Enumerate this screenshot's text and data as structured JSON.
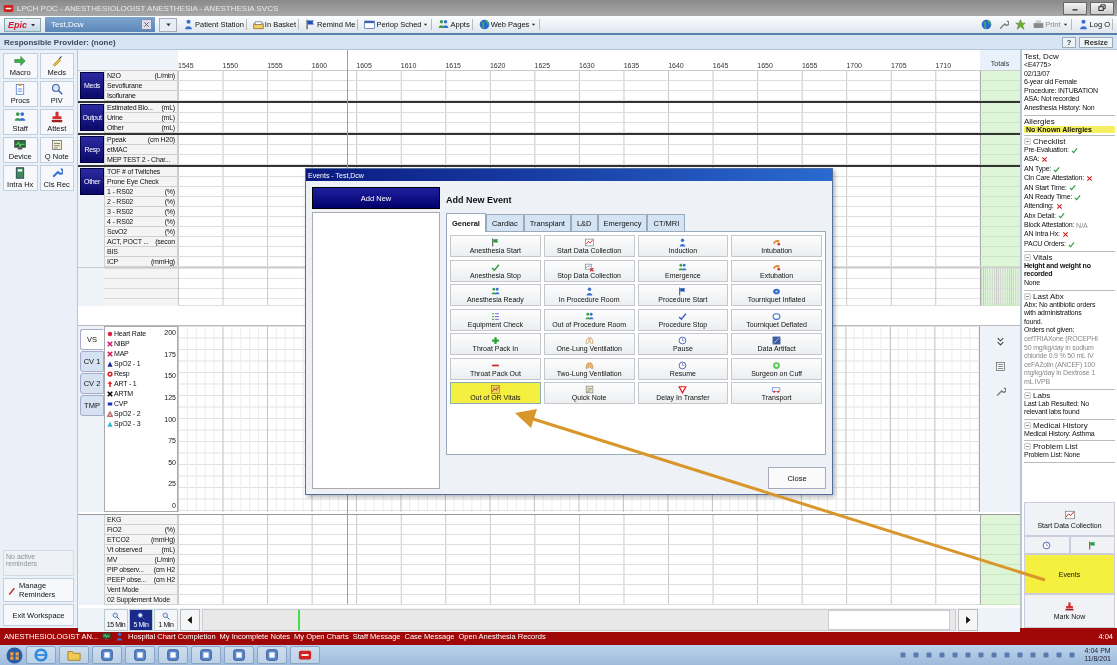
{
  "window": {
    "title": "LPCH POC - ANESTHESIOLOGIST ANESTHESIA - ANESTHESIA SVCS"
  },
  "toolbar": {
    "app_button": "Epic",
    "patient_tab": "Test,Dcw",
    "items": [
      {
        "label": "Patient Station",
        "dropdown": false
      },
      {
        "label": "In Basket",
        "dropdown": false
      },
      {
        "label": "Remind Me",
        "dropdown": false
      },
      {
        "label": "Periop Sched",
        "dropdown": true
      },
      {
        "label": "Appts",
        "dropdown": false
      },
      {
        "label": "Web Pages",
        "dropdown": true
      }
    ],
    "right_items": [
      {
        "label": "Print",
        "dropdown": true
      },
      {
        "label": "Log O",
        "dropdown": false
      }
    ]
  },
  "header": {
    "provider": "Responsible Provider: (none)",
    "help": "?",
    "resize": "Resize"
  },
  "sidebar": {
    "buttons": [
      "Macro",
      "Meds",
      "Procs",
      "PIV",
      "Staff",
      "Attest",
      "Device",
      "Q Note",
      "Intra Hx",
      "Cls Rec"
    ],
    "reminders": "No active reminders",
    "manage": "Manage Reminders",
    "exit": "Exit Workspace"
  },
  "flowsheet": {
    "times": [
      "1545",
      "1550",
      "1555",
      "1600",
      "1605",
      "1610",
      "1615",
      "1620",
      "1625",
      "1630",
      "1635",
      "1640",
      "1645",
      "1650",
      "1655",
      "1700",
      "1705",
      "1710"
    ],
    "totals": "Totals",
    "groups": [
      {
        "label": "Meds",
        "rows": [
          {
            "name": "N2O",
            "unit": "(L/min)"
          },
          {
            "name": "Sevoflurane"
          },
          {
            "name": "Isoflurane"
          }
        ]
      },
      {
        "label": "Output",
        "rows": [
          {
            "name": "Estimated Blo...",
            "unit": "(mL)"
          },
          {
            "name": "Urine",
            "unit": "(mL)"
          },
          {
            "name": "Other",
            "unit": "(mL)"
          }
        ]
      },
      {
        "label": "Resp",
        "rows": [
          {
            "name": "Ppeak",
            "unit": "(cm H20)"
          },
          {
            "name": "etMAC"
          },
          {
            "name": "MEP TEST 2 - Char..."
          }
        ]
      },
      {
        "label": "Other",
        "rows": [
          {
            "name": "TOF # of Twitches"
          },
          {
            "name": "Prone Eye Check"
          },
          {
            "name": "1 - RS02",
            "unit": "(%)"
          },
          {
            "name": "2 - RS02",
            "unit": "(%)"
          },
          {
            "name": "3 - RS02",
            "unit": "(%)"
          },
          {
            "name": "4 - RS02",
            "unit": "(%)"
          },
          {
            "name": "ScvO2",
            "unit": "(%)"
          },
          {
            "name": "ACT, POCT ...",
            "unit": "(secon"
          },
          {
            "name": "BIS"
          },
          {
            "name": "ICP",
            "unit": "(mmHg)"
          }
        ]
      }
    ]
  },
  "vitals": {
    "tabs": [
      {
        "label": "VS",
        "selected": true
      },
      {
        "label": "CV 1",
        "selected": false
      },
      {
        "label": "CV 2",
        "selected": false
      },
      {
        "label": "TMP",
        "selected": false
      }
    ],
    "legend": [
      {
        "label": "Heart Rate",
        "kind": "dot",
        "color": "#e0204a"
      },
      {
        "label": "NIBP",
        "kind": "x",
        "color": "#d01870"
      },
      {
        "label": "MAP",
        "kind": "x",
        "color": "#d01850"
      },
      {
        "label": "SpO2 - 1",
        "kind": "triangle",
        "color": "#1a2a9a"
      },
      {
        "label": "Resp",
        "kind": "ring",
        "color": "#e02020"
      },
      {
        "label": "ART - 1",
        "kind": "arrow",
        "color": "#e02020"
      },
      {
        "label": "ARTM",
        "kind": "x",
        "color": "#000000"
      },
      {
        "label": "CVP",
        "kind": "square",
        "color": "#2030c0"
      },
      {
        "label": "SpO2 - 2",
        "kind": "triangle-outline",
        "color": "#c07070"
      },
      {
        "label": "SpO2 - 3",
        "kind": "triangle",
        "color": "#30c0d0"
      }
    ],
    "y_ticks": [
      "200",
      "175",
      "150",
      "125",
      "100",
      "75",
      "50",
      "25",
      "0"
    ]
  },
  "bottom_rows": [
    {
      "name": "EKG"
    },
    {
      "name": "FiO2",
      "unit": "(%)"
    },
    {
      "name": "ETCO2",
      "unit": "(mmHg)"
    },
    {
      "name": "Vt observed",
      "unit": "(mL)"
    },
    {
      "name": "MV",
      "unit": "(L/min)"
    },
    {
      "name": "PIP observ...",
      "unit": "(cm H2"
    },
    {
      "name": "PEEP obse...",
      "unit": "(cm H2"
    },
    {
      "name": "Vent Mode"
    },
    {
      "name": "02 Supplement Mode"
    }
  ],
  "zoom_buttons": [
    {
      "label": "15 Min",
      "selected": false
    },
    {
      "label": "5 Min",
      "selected": true
    },
    {
      "label": "1 Min",
      "selected": false
    }
  ],
  "dialog": {
    "title": "Events - Test,Dcw",
    "add_new": "Add New",
    "heading": "Add New Event",
    "tabs": [
      {
        "label": "General",
        "selected": true
      },
      {
        "label": "Cardiac",
        "selected": false
      },
      {
        "label": "Transplant",
        "selected": false
      },
      {
        "label": "L&D",
        "selected": false
      },
      {
        "label": "Emergency",
        "selected": false
      },
      {
        "label": "CT/MRI",
        "selected": false
      }
    ],
    "events": [
      {
        "label": "Anesthesia Start",
        "highlighted": false
      },
      {
        "label": "Start Data Collection",
        "highlighted": false
      },
      {
        "label": "Induction",
        "highlighted": false
      },
      {
        "label": "Intubation",
        "highlighted": false
      },
      {
        "label": "Anesthesia Stop",
        "highlighted": false
      },
      {
        "label": "Stop Data Collection",
        "highlighted": false
      },
      {
        "label": "Emergence",
        "highlighted": false
      },
      {
        "label": "Extubation",
        "highlighted": false
      },
      {
        "label": "Anesthesia Ready",
        "highlighted": false
      },
      {
        "label": "In Procedure Room",
        "highlighted": false
      },
      {
        "label": "Procedure Start",
        "highlighted": false
      },
      {
        "label": "Tourniquet Inflated",
        "highlighted": false
      },
      {
        "label": "Equipment Check",
        "highlighted": false
      },
      {
        "label": "Out of Procedure Room",
        "highlighted": false
      },
      {
        "label": "Procedure Stop",
        "highlighted": false
      },
      {
        "label": "Tourniquet Deflated",
        "highlighted": false
      },
      {
        "label": "Throat Pack In",
        "highlighted": false
      },
      {
        "label": "One-Lung Ventilation",
        "highlighted": false
      },
      {
        "label": "Pause",
        "highlighted": false
      },
      {
        "label": "Data Artifact",
        "highlighted": false
      },
      {
        "label": "Throat Pack Out",
        "highlighted": false
      },
      {
        "label": "Two-Lung Ventilation",
        "highlighted": false
      },
      {
        "label": "Resume",
        "highlighted": false
      },
      {
        "label": "Surgeon on Cuff",
        "highlighted": false
      },
      {
        "label": "Out of OR Vitals",
        "highlighted": true
      },
      {
        "label": "Quick Note",
        "highlighted": false
      },
      {
        "label": "Delay In Transfer",
        "highlighted": false
      },
      {
        "label": "Transport",
        "highlighted": false
      }
    ],
    "close": "Close"
  },
  "patient": {
    "name": "Test, Dcw",
    "details": [
      "<E4775>",
      "02/13/07",
      "6-year old Female",
      "Procedure: INTUBATION",
      "ASA: Not recorded",
      "Anesthesia History: Non"
    ]
  },
  "allergies": {
    "title": "Allergies",
    "value": "No Known Allergies"
  },
  "checklist": {
    "title": "Checklist",
    "expanded": true,
    "items": [
      {
        "label": "Pre-Evaluation:",
        "kind": "done"
      },
      {
        "label": "ASA:",
        "kind": "missing"
      },
      {
        "label": "AN Type:",
        "kind": "done"
      },
      {
        "label": "Cln Care Attestation:",
        "kind": "missing"
      },
      {
        "label": "AN Start Time:",
        "kind": "done"
      },
      {
        "label": "AN Ready Time:",
        "kind": "done"
      },
      {
        "label": "Attending:",
        "kind": "missing"
      },
      {
        "label": "Abx Detail:",
        "kind": "done"
      },
      {
        "label": "Block Attestation:",
        "kind": "na",
        "note": "N/A"
      },
      {
        "label": "AN Intra Hx:",
        "kind": "missing"
      },
      {
        "label": "PACU Orders:",
        "kind": "done"
      }
    ]
  },
  "sections": [
    {
      "title": "Vitals",
      "expanded": true,
      "lines": [
        {
          "text": "Height and weight no",
          "kind": "bold"
        },
        {
          "text": "recorded",
          "kind": "bold"
        },
        {
          "text": "None",
          "kind": "plain"
        }
      ]
    },
    {
      "title": "Last Abx",
      "expanded": true,
      "lines": [
        {
          "text": "Abx: No antibiotic orders",
          "kind": "plain"
        },
        {
          "text": "with administrations",
          "kind": "plain"
        },
        {
          "text": "found.",
          "kind": "plain"
        },
        {
          "text": "Orders not given:",
          "kind": "plain"
        },
        {
          "text": "cefTRIAXone (ROCEPHI",
          "kind": "grey"
        },
        {
          "text": "50 mg/kg/day in sodium",
          "kind": "grey"
        },
        {
          "text": "chloride 0.9 % 50 mL IV",
          "kind": "grey"
        },
        {
          "text": "ceFAZolin (ANCEF) 100",
          "kind": "grey"
        },
        {
          "text": "mg/kg/day in Dextrose 1",
          "kind": "grey"
        },
        {
          "text": "mL IVPB",
          "kind": "grey"
        }
      ]
    },
    {
      "title": "Labs",
      "expanded": true,
      "lines": [
        {
          "text": "Last Lab Resulted: No",
          "kind": "plain"
        },
        {
          "text": "relevant labs found",
          "kind": "plain"
        }
      ]
    },
    {
      "title": "Medical History",
      "expanded": true,
      "lines": [
        {
          "text": "Medical History: Asthma",
          "kind": "plain"
        }
      ]
    },
    {
      "title": "Problem List",
      "expanded": true,
      "lines": [
        {
          "text": "Problem List: None",
          "kind": "plain"
        }
      ]
    }
  ],
  "action_buttons": [
    {
      "label": "Start Data Collection",
      "highlighted": false
    },
    {
      "label": "Events",
      "highlighted": true
    },
    {
      "label": "Mark Now",
      "highlighted": false
    }
  ],
  "status_bar": {
    "user": "ANESTHESIOLOGIST AN...",
    "links": [
      "Hospital Chart Completion",
      "My Incomplete Notes",
      "My Open Charts",
      "Staff Message",
      "Case Message",
      "Open Anesthesia Records"
    ],
    "time": "4:04"
  },
  "taskbar": {
    "time": "4:04 PM",
    "date": "11/8/201"
  }
}
